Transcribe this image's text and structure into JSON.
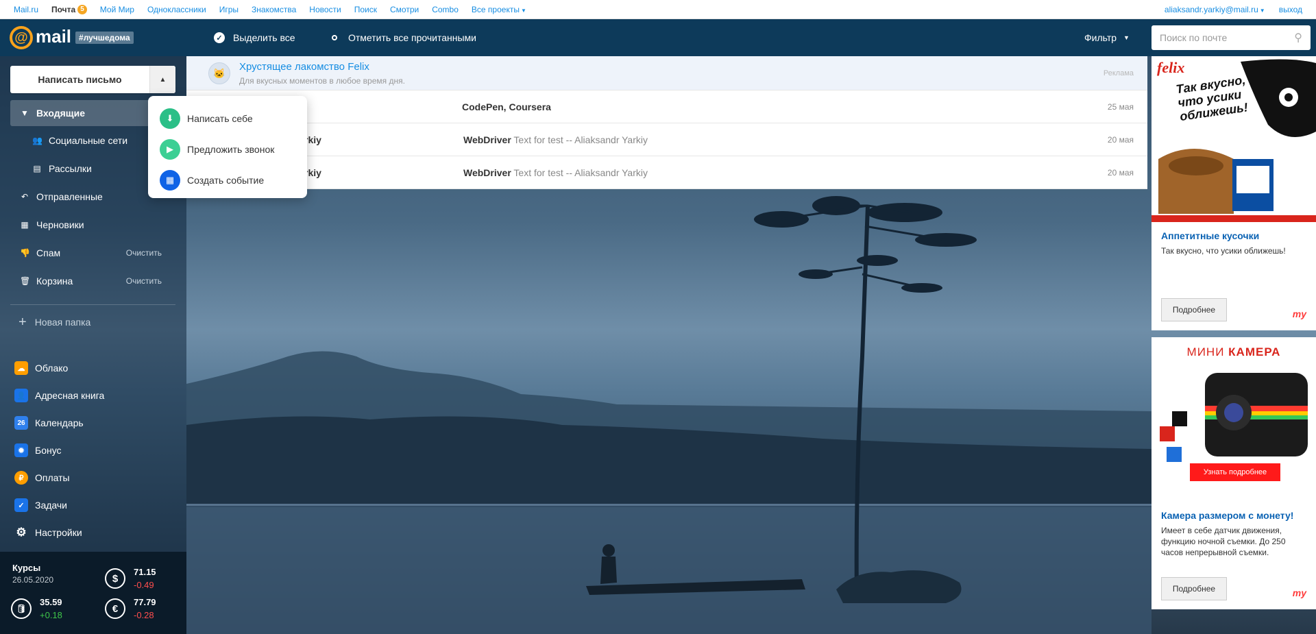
{
  "portal": {
    "links": [
      "Mail.ru",
      "Почта",
      "Мой Мир",
      "Одноклассники",
      "Игры",
      "Знакомства",
      "Новости",
      "Поиск",
      "Смотри",
      "Combo",
      "Все проекты"
    ],
    "mail_count": "5",
    "user_email": "aliaksandr.yarkiy@mail.ru",
    "logout": "выход"
  },
  "header": {
    "logo_word": "mail",
    "logo_tag": "#лучшедома",
    "select_all": "Выделить все",
    "mark_all_read": "Отметить все прочитанными",
    "filter": "Фильтр",
    "search_placeholder": "Поиск по почте"
  },
  "sidebar": {
    "compose": "Написать письмо",
    "folders": [
      {
        "label": "Входящие",
        "icon": "chevron-down-icon"
      },
      {
        "label": "Социальные сети",
        "icon": "people-icon"
      },
      {
        "label": "Рассылки",
        "icon": "newsletter-icon"
      },
      {
        "label": "Отправленные",
        "icon": "reply-icon"
      },
      {
        "label": "Черновики",
        "icon": "draft-icon"
      },
      {
        "label": "Спам",
        "icon": "thumb-down-icon",
        "action": "Очистить"
      },
      {
        "label": "Корзина",
        "icon": "trash-icon",
        "action": "Очистить"
      }
    ],
    "new_folder": "Новая папка",
    "services": [
      {
        "label": "Облако",
        "color": "#ff9e00"
      },
      {
        "label": "Адресная книга",
        "color": "#1a73e8"
      },
      {
        "label": "Календарь",
        "color": "#2f80ed",
        "badge": "26"
      },
      {
        "label": "Бонус",
        "color": "#1a73e8"
      },
      {
        "label": "Оплаты",
        "color": "#ff9e00"
      },
      {
        "label": "Задачи",
        "color": "#1a73e8"
      },
      {
        "label": "Настройки",
        "color": "#ffffff"
      }
    ]
  },
  "rates": {
    "title": "Курсы",
    "date": "26.05.2020",
    "usd": {
      "value": "71.15",
      "change": "-0.49"
    },
    "oil": {
      "value": "35.59",
      "change": "+0.18"
    },
    "eur": {
      "value": "77.79",
      "change": "-0.28"
    }
  },
  "messages": {
    "ad": {
      "title": "Хрустящее лакомство Felix",
      "subtitle": "Для вкусных моментов в любое время дня.",
      "mark": "Реклама"
    },
    "items": [
      {
        "sender": "",
        "subject_bold": "CodePen, Coursera",
        "snippet": "",
        "date": "25 мая"
      },
      {
        "sender": "rkiy",
        "subject_bold": "WebDriver",
        "snippet": "Text for test -- Aliaksandr Yarkiy",
        "date": "20 мая"
      },
      {
        "sender": "rkiy",
        "subject_bold": "WebDriver",
        "snippet": "Text for test -- Aliaksandr Yarkiy",
        "date": "20 мая"
      }
    ]
  },
  "compose_menu": [
    {
      "label": "Написать себе",
      "color": "#2bbf87"
    },
    {
      "label": "Предложить звонок",
      "color": "#3ccf94"
    },
    {
      "label": "Создать событие",
      "color": "#0f63e6"
    }
  ],
  "ads": {
    "felix": {
      "brand": "felix",
      "image_text": "Так вкусно, что усики оближешь!",
      "title": "Аппетитные кусочки",
      "text": "Так вкусно, что усики оближешь!",
      "button": "Подробнее",
      "logo": "my"
    },
    "camera": {
      "image_title_a": "МИНИ",
      "image_title_b": "КАМЕРА",
      "image_button": "Узнать подробнее",
      "title": "Камера размером с монету!",
      "text": "Имеет в себе датчик движения, функцию ночной съемки. До 250 часов непрерывной съемки.",
      "button": "Подробнее",
      "logo": "my"
    }
  }
}
